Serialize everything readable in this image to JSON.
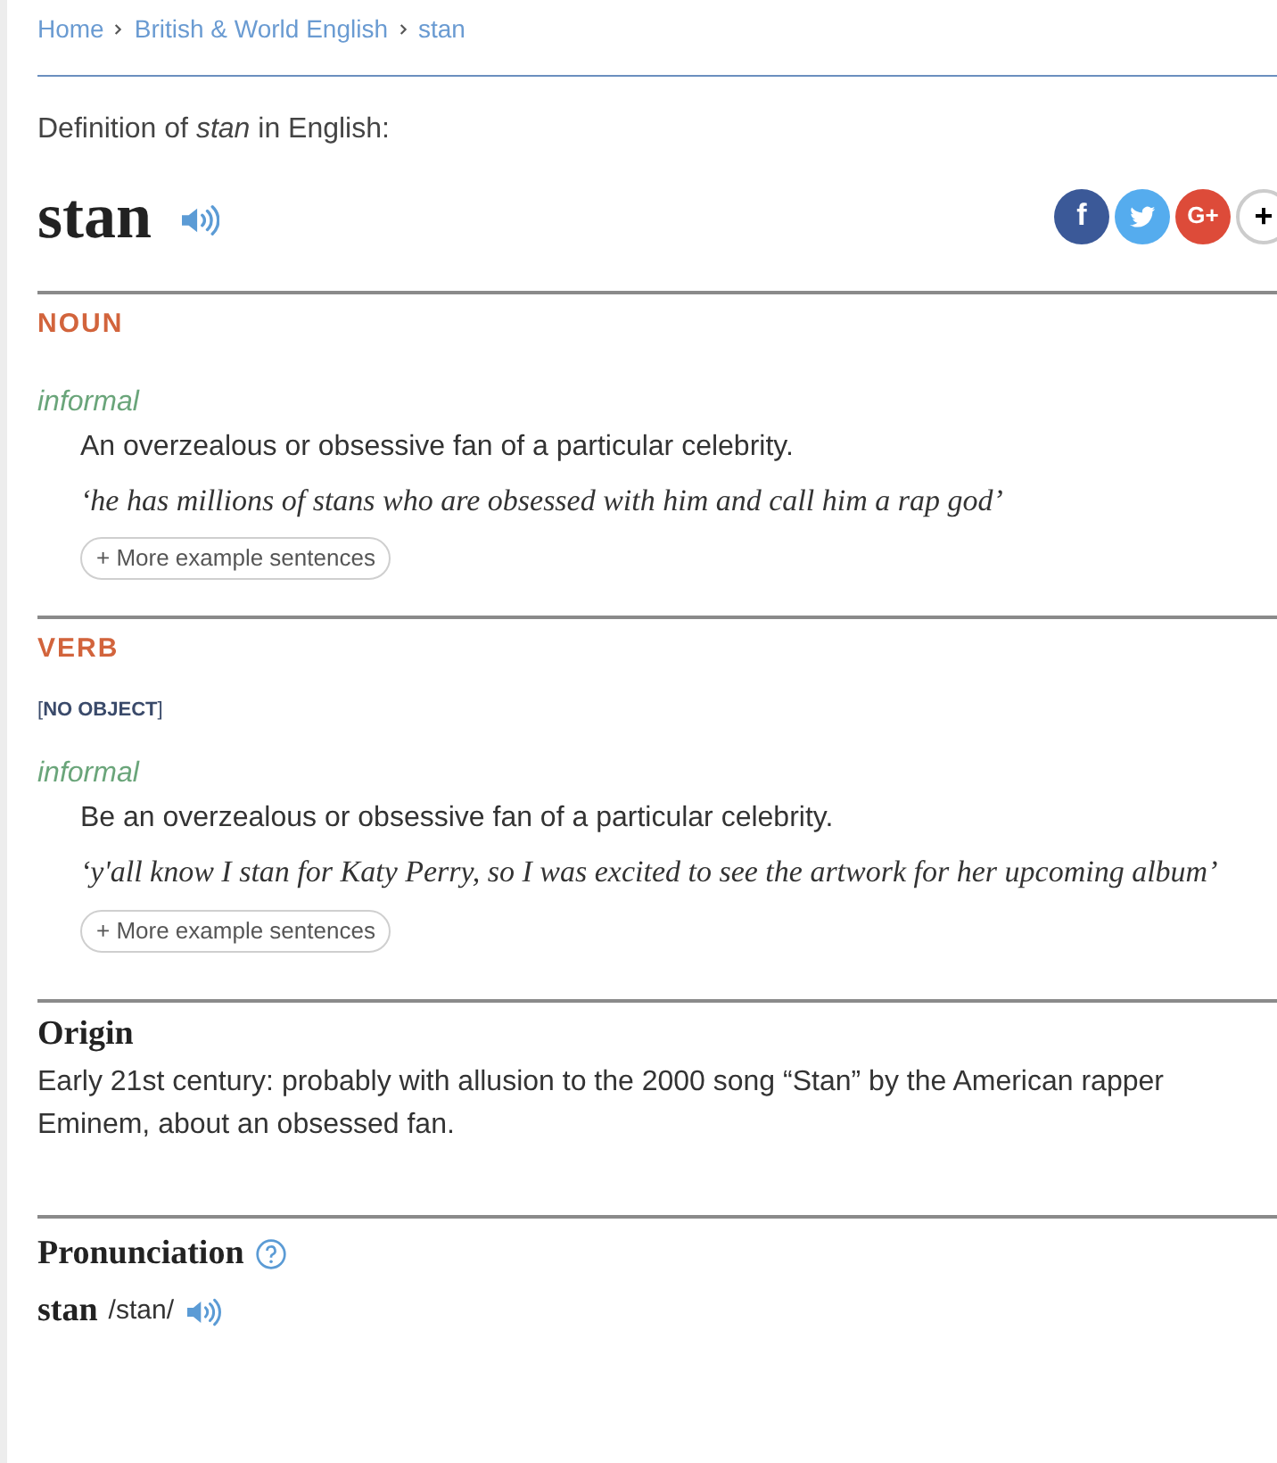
{
  "breadcrumbs": [
    {
      "label": "Home"
    },
    {
      "label": "British & World English"
    },
    {
      "label": "stan"
    }
  ],
  "intro": "Definition of *stan* in English:",
  "headword": "stan",
  "share": [
    {
      "kind": "facebook",
      "label": "f",
      "color": "#3b5998"
    },
    {
      "kind": "twitter",
      "color": "#55acee"
    },
    {
      "kind": "googleplus",
      "label": "G+",
      "color": "#dd4b39"
    },
    {
      "kind": "more",
      "label": "+"
    }
  ],
  "senses": [
    {
      "pos": "NOUN",
      "register": "informal",
      "definition": "An overzealous or obsessive fan of a particular celebrity.",
      "example": "‘he has millions of stans who are obsessed with him and call him a rap god’",
      "more": "+ More example sentences"
    },
    {
      "pos": "VERB",
      "grammar": "[**NO OBJECT**]",
      "register": "informal",
      "definition": "Be an overzealous or obsessive fan of a particular celebrity.",
      "example": "‘y'all know I stan for Katy Perry, so I was excited to see the artwork for her upcoming album’",
      "more": "+ More example sentences"
    }
  ],
  "origin": {
    "title": "Origin",
    "text": "Early 21st century: probably with allusion to the 2000 song “Stan” by the American rapper Eminem, about an obsessed fan."
  },
  "pronunciation": {
    "title": "Pronunciation",
    "word": "stan",
    "ipa": "/stan/"
  }
}
